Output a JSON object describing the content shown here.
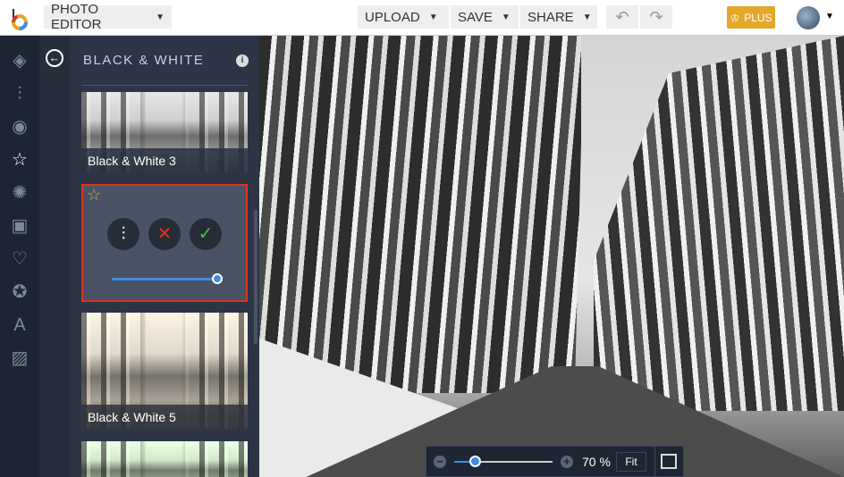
{
  "header": {
    "app_menu": "PHOTO EDITOR",
    "upload": "UPLOAD",
    "save": "SAVE",
    "share": "SHARE",
    "plus": "PLUS"
  },
  "panel": {
    "title": "BLACK & WHITE",
    "thumbnails": [
      {
        "label": "Black & White 3"
      },
      {
        "label": ""
      },
      {
        "label": "Black & White 5"
      },
      {
        "label": ""
      }
    ],
    "intensity": 1.0
  },
  "zoom": {
    "value": "70 %",
    "fit": "Fit",
    "minus": "−",
    "plus": "+"
  },
  "colors": {
    "accent": "#e3a82b",
    "selection": "#e0321e",
    "slider": "#3d8ee0"
  }
}
